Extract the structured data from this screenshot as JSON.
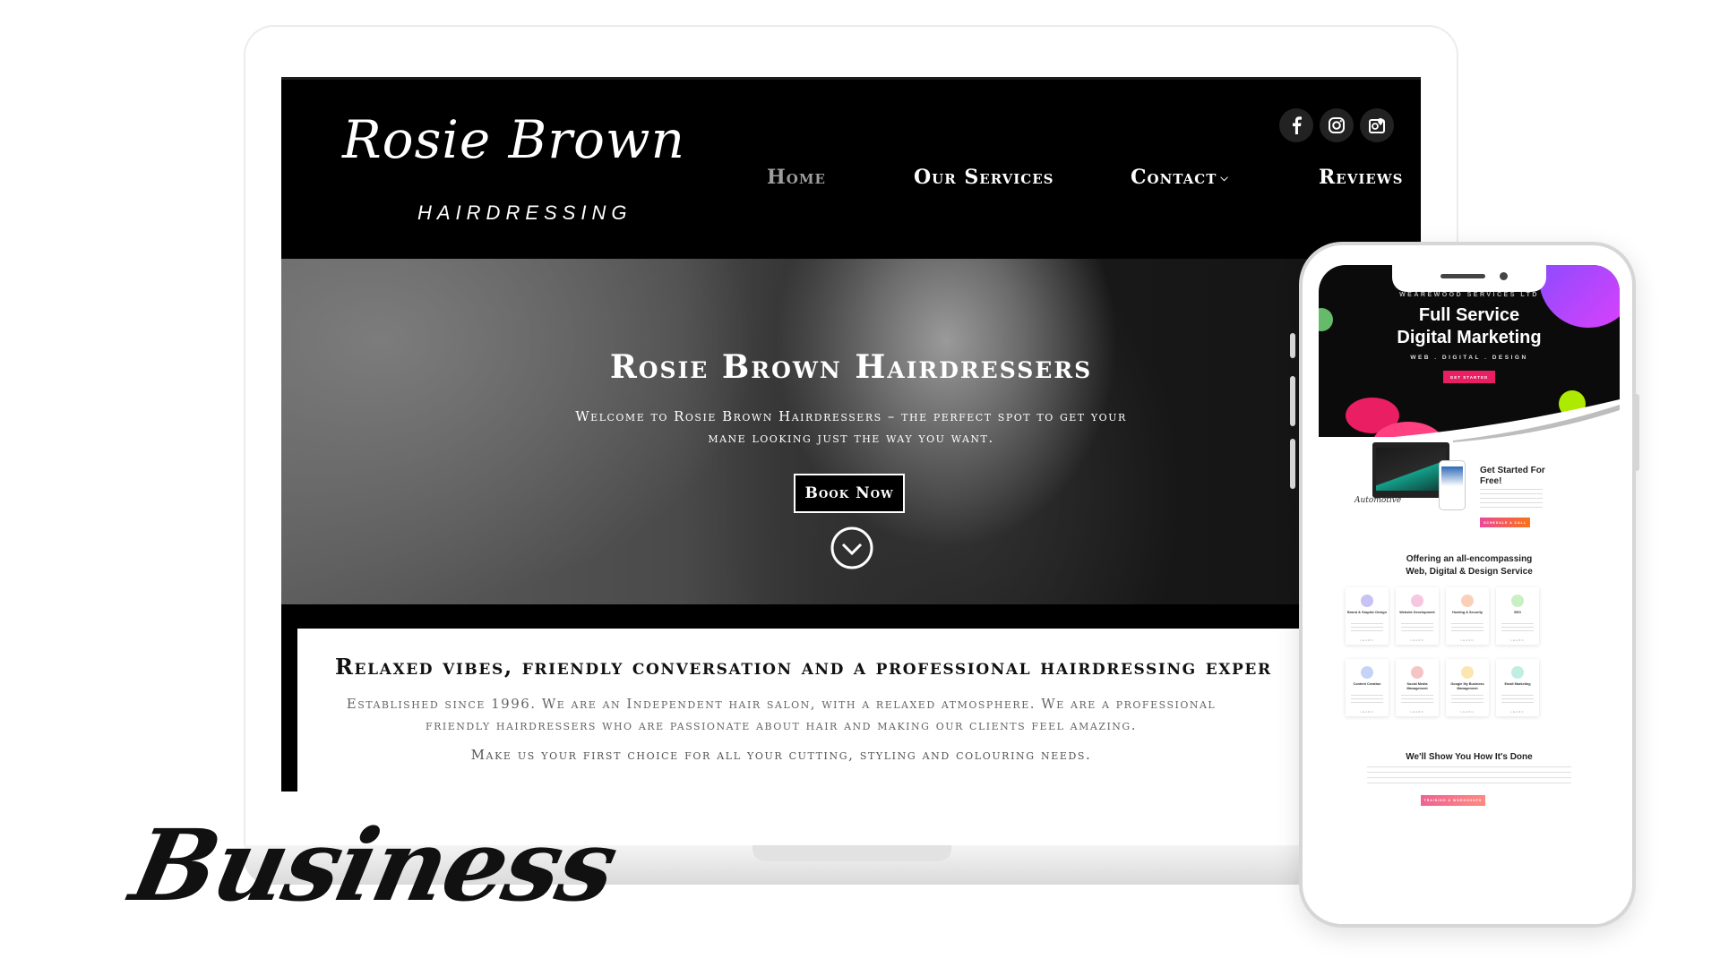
{
  "laptop_site": {
    "logo_main": "Rosie Brown",
    "logo_sub": "HAIRDRESSING",
    "nav": {
      "home": "Home",
      "services": "Our Services",
      "contact": "Contact",
      "reviews": "Reviews"
    },
    "hero": {
      "title": "Rosie Brown Hairdressers",
      "text": "Welcome to Rosie Brown Hairdressers – the perfect spot to get your mane looking just the way you want.",
      "button": "Book Now"
    },
    "about": {
      "title": "Relaxed vibes, friendly conversation and a professional hairdressing exper",
      "text": "Established since 1996. We are an Independent hair salon, with a relaxed atmosphere. We are a professional friendly hairdressers who are passionate about hair and making our clients feel amazing.",
      "text2": "Make us your first choice for all your cutting, styling and colouring needs."
    },
    "social_icons": [
      "facebook-icon",
      "instagram-icon",
      "google-business-icon"
    ]
  },
  "phone_site": {
    "kicker": "WEAREWOOD SERVICES LTD",
    "title_line1": "Full Service",
    "title_line2": "Digital Marketing",
    "subtitle": "WEB . DIGITAL . DESIGN",
    "cta": "GET STARTED",
    "signature": "Automotive",
    "get_started_title": "Get Started For Free!",
    "get_started_button": "SCHEDULE A CALL",
    "offer_title_line1": "Offering an all-encompassing",
    "offer_title_line2": "Web, Digital & Design Service",
    "cards": [
      {
        "title": "Brand & Graphic Design",
        "color": "#c7c3f5"
      },
      {
        "title": "Website Development",
        "color": "#f7c6e0"
      },
      {
        "title": "Hosting & Security",
        "color": "#fbd0b8"
      },
      {
        "title": "SEO",
        "color": "#c9efc4"
      },
      {
        "title": "Content Creation",
        "color": "#c4d4f7"
      },
      {
        "title": "Social Media Management",
        "color": "#f5c4c4"
      },
      {
        "title": "Google My Business Management",
        "color": "#fbe6b0"
      },
      {
        "title": "Email Marketing",
        "color": "#bfeee3"
      }
    ],
    "card_link": "LEARN",
    "show_title": "We'll Show You How It's Done",
    "show_button": "TRAINING & WORKSHOPS"
  },
  "category_label": "Business",
  "colors": {
    "accent_pink": "#e91e63",
    "site_background": "#000000"
  }
}
